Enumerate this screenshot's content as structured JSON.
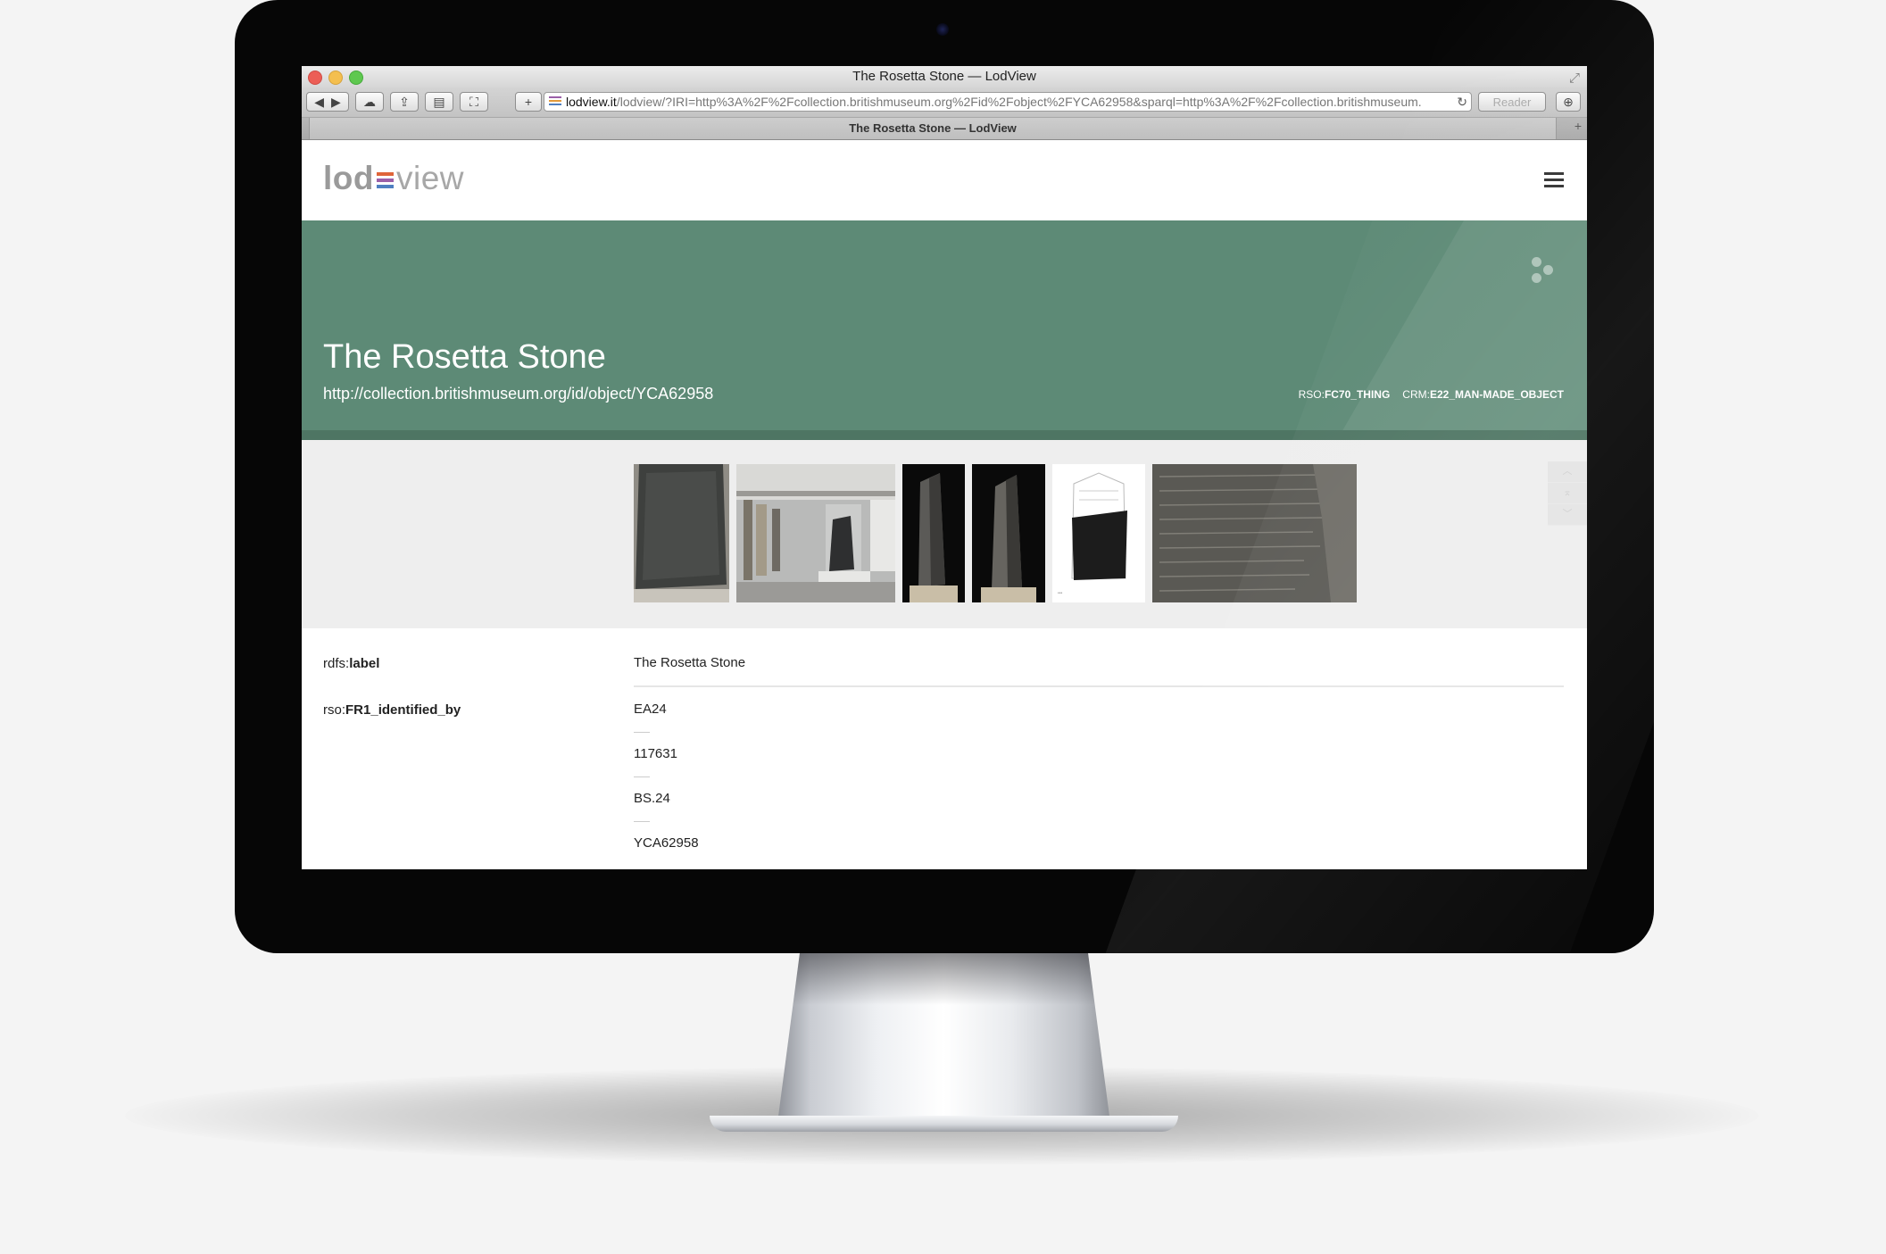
{
  "browser": {
    "window_title": "The Rosetta Stone — LodView",
    "address_domain": "lodview.it",
    "address_path": "/lodview/?IRI=http%3A%2F%2Fcollection.britishmuseum.org%2Fid%2Fobject%2FYCA62958&sparql=http%3A%2F%2Fcollection.britishmuseum.",
    "reader_label": "Reader",
    "tab_title": "The Rosetta Stone — LodView",
    "favicon_colors": [
      "#9b5fa8",
      "#e39a3b",
      "#4f7fc1"
    ]
  },
  "logo": {
    "part1": "lod",
    "part2": "view",
    "mark_colors": [
      "#e0653a",
      "#9b5fa8",
      "#4f7fc1"
    ]
  },
  "hero": {
    "title": "The Rosetta Stone",
    "uri": "http://collection.britishmuseum.org/id/object/YCA62958",
    "types": [
      {
        "prefix": "RSO:",
        "name": "FC70_THING"
      },
      {
        "prefix": "CRM:",
        "name": "E22_MAN-MADE_OBJECT"
      }
    ],
    "color": "#5d8a76"
  },
  "gallery": {
    "images": [
      {
        "name": "rosetta-stone-closeup-image"
      },
      {
        "name": "museum-gallery-image"
      },
      {
        "name": "stone-side-view-image-1"
      },
      {
        "name": "stone-side-view-image-2"
      },
      {
        "name": "stone-drawing-image"
      },
      {
        "name": "inscription-detail-image"
      }
    ]
  },
  "properties": [
    {
      "prefix": "rdfs:",
      "name": "label",
      "values": [
        "The Rosetta Stone"
      ]
    },
    {
      "prefix": "rso:",
      "name": "FR1_identified_by",
      "values": [
        "EA24",
        "117631",
        "BS.24",
        "YCA62958"
      ]
    }
  ]
}
